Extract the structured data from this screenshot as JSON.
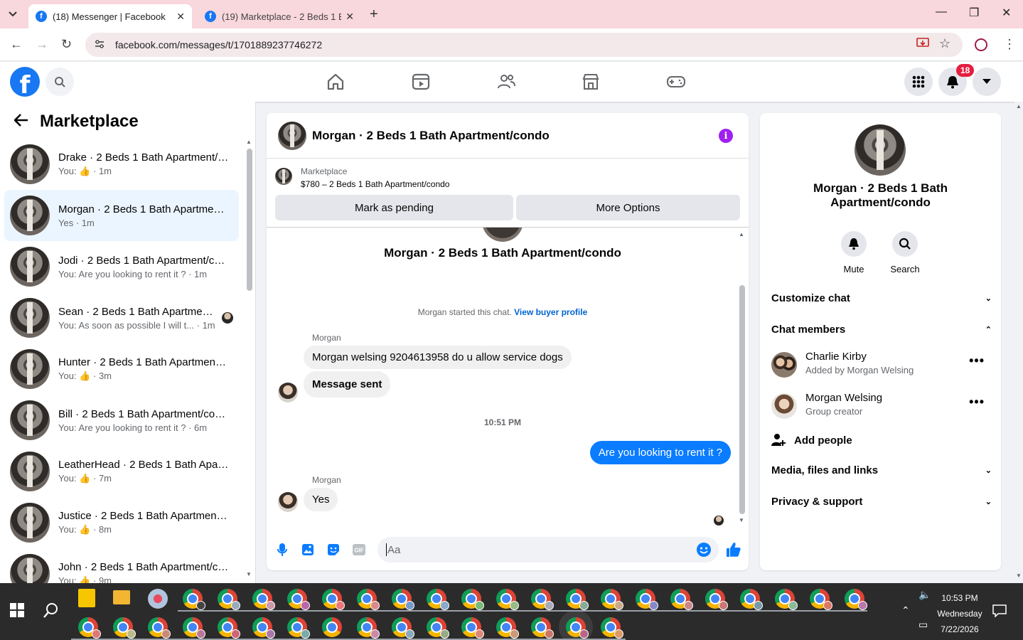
{
  "browser": {
    "tabs": [
      {
        "title": "(18) Messenger | Facebook",
        "active": true
      },
      {
        "title": "(19) Marketplace - 2 Beds 1 Bath",
        "active": false
      }
    ],
    "url": "facebook.com/messages/t/1701889237746272"
  },
  "fb_header": {
    "logo": "f",
    "notification_count": "18"
  },
  "sidebar": {
    "title": "Marketplace",
    "conversations": [
      {
        "name": "Drake · 2 Beds 1 Bath Apartment/condo",
        "preview": "You:",
        "like": true,
        "time": "· 1m"
      },
      {
        "name": "Morgan · 2 Beds 1 Bath Apartment/condo",
        "preview": "Yes",
        "like": false,
        "time": "· 1m",
        "selected": true
      },
      {
        "name": "Jodi · 2 Beds 1 Bath Apartment/condo",
        "preview": "You: Are you looking to rent it ?",
        "like": false,
        "time": "· 1m"
      },
      {
        "name": "Sean · 2 Beds 1 Bath Apartment/condo",
        "preview": "You: As soon as possible I will t...",
        "like": false,
        "time": "· 1m",
        "seen": true
      },
      {
        "name": "Hunter · 2 Beds 1 Bath Apartment/condo",
        "preview": "You:",
        "like": true,
        "time": "· 3m"
      },
      {
        "name": "Bill · 2 Beds 1 Bath Apartment/condo",
        "preview": "You: Are you looking to rent it ?",
        "like": false,
        "time": "· 6m"
      },
      {
        "name": "LeatherHead · 2 Beds 1 Bath Apartment/condo",
        "preview": "You:",
        "like": true,
        "time": "· 7m"
      },
      {
        "name": "Justice · 2 Beds 1 Bath Apartment/condo",
        "preview": "You:",
        "like": true,
        "time": "· 8m"
      },
      {
        "name": "John · 2 Beds 1 Bath Apartment/condo",
        "preview": "You:",
        "like": true,
        "time": "· 9m"
      }
    ]
  },
  "chat": {
    "title": "Morgan · 2 Beds 1 Bath Apartment/condo",
    "marketplace_label": "Marketplace",
    "listing": "$780 – 2 Beds 1 Bath Apartment/condo",
    "btn_pending": "Mark as pending",
    "btn_more": "More Options",
    "hero_title": "Morgan · 2 Beds 1 Bath Apartment/condo",
    "started_text": "Morgan started this chat.",
    "buyer_profile_link": "View buyer profile",
    "messages": [
      {
        "sender": "Morgan",
        "text": "Morgan welsing 9204613958 do u allow service dogs"
      },
      {
        "text": "Message sent"
      },
      {
        "timestamp": "10:51 PM"
      },
      {
        "outgoing": true,
        "text": "Are you looking to rent it ?"
      },
      {
        "sender": "Morgan",
        "text": "Yes"
      }
    ],
    "composer_placeholder": "Aa"
  },
  "details": {
    "name": "Morgan · 2 Beds 1 Bath Apartment/condo",
    "actions": [
      {
        "label": "Mute",
        "icon": "bell-icon"
      },
      {
        "label": "Search",
        "icon": "search-icon"
      }
    ],
    "customize": "Customize chat",
    "members_heading": "Chat members",
    "members": [
      {
        "name": "Charlie Kirby",
        "sub": "Added by Morgan Welsing"
      },
      {
        "name": "Morgan Welsing",
        "sub": "Group creator"
      }
    ],
    "add_people": "Add people",
    "media": "Media, files and links",
    "privacy": "Privacy & support"
  },
  "taskbar": {
    "time": "10:53 PM",
    "day": "Wednesday",
    "date": "7/22/2026"
  }
}
